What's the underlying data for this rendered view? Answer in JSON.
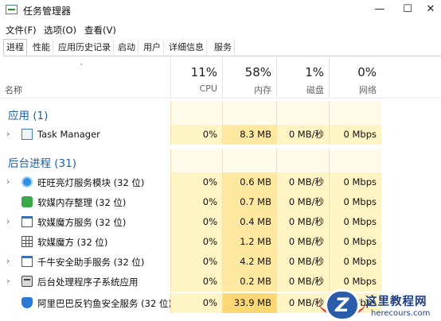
{
  "window": {
    "title": "任务管理器",
    "minimize": "—",
    "maximize": "☐",
    "close": "✕"
  },
  "menu": [
    "文件(F)",
    "选项(O)",
    "查看(V)"
  ],
  "tabs": [
    "进程",
    "性能",
    "应用历史记录",
    "启动",
    "用户",
    "详细信息",
    "服务"
  ],
  "columns": {
    "name": "名称",
    "sort_arrow": "˅",
    "cpu": {
      "pct": "11%",
      "label": "CPU"
    },
    "mem": {
      "pct": "58%",
      "label": "内存"
    },
    "disk": {
      "pct": "1%",
      "label": "磁盘"
    },
    "net": {
      "pct": "0%",
      "label": "网络"
    }
  },
  "groups": {
    "apps": "应用 (1)",
    "background": "后台进程 (31)"
  },
  "chevron": "›",
  "processes": [
    {
      "name": "Task Manager",
      "cpu": "0%",
      "mem": "8.3 MB",
      "disk": "0 MB/秒",
      "net": "0 Mbps",
      "icon": "task-manager-icon"
    },
    {
      "name": "旺旺亮灯服务模块 (32 位)",
      "cpu": "0%",
      "mem": "0.6 MB",
      "disk": "0 MB/秒",
      "net": "0 Mbps",
      "icon": "globe-icon"
    },
    {
      "name": "软媒内存整理 (32 位)",
      "cpu": "0%",
      "mem": "0.7 MB",
      "disk": "0 MB/秒",
      "net": "0 Mbps",
      "icon": "memory-cleaner-icon"
    },
    {
      "name": "软媒魔方服务 (32 位)",
      "cpu": "0%",
      "mem": "0.4 MB",
      "disk": "0 MB/秒",
      "net": "0 Mbps",
      "icon": "service-window-icon"
    },
    {
      "name": "软媒魔方 (32 位)",
      "cpu": "0%",
      "mem": "1.2 MB",
      "disk": "0 MB/秒",
      "net": "0 Mbps",
      "icon": "grid-icon"
    },
    {
      "name": "千牛安全助手服务 (32 位)",
      "cpu": "0%",
      "mem": "4.2 MB",
      "disk": "0 MB/秒",
      "net": "0 Mbps",
      "icon": "service-window-icon"
    },
    {
      "name": "后台处理程序子系统应用",
      "cpu": "0%",
      "mem": "0.2 MB",
      "disk": "0 MB/秒",
      "net": "0 Mbps",
      "icon": "printer-icon"
    },
    {
      "name": "阿里巴巴反钓鱼安全服务 (32 位)",
      "cpu": "0%",
      "mem": "33.9 MB",
      "disk": "0 MB/秒",
      "net": "0 Mbps",
      "icon": "shield-icon"
    }
  ],
  "watermark": {
    "title": "这里教程网",
    "url": "herecours.com"
  }
}
